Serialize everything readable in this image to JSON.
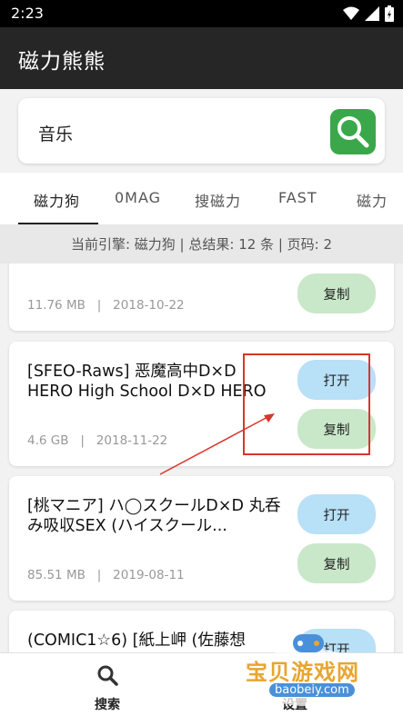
{
  "status_bar": {
    "time": "2:23"
  },
  "app_bar": {
    "title": "磁力熊熊"
  },
  "search": {
    "query": "音乐"
  },
  "tabs": [
    {
      "label": "磁力狗",
      "active": true
    },
    {
      "label": "0MAG",
      "active": false
    },
    {
      "label": "搜磁力",
      "active": false
    },
    {
      "label": "FAST",
      "active": false
    },
    {
      "label": "磁力",
      "active": false
    }
  ],
  "info_bar": {
    "text": "当前引擎: 磁力狗 | 总结果: 12 条 | 页码: 2"
  },
  "results": [
    {
      "name": "",
      "size": "11.76 MB",
      "date": "2018-10-22",
      "copy_label": "复制"
    },
    {
      "name": "[SFEO-Raws] 恶魔高中D×D HERO High School D×D HERO ...",
      "size": "4.6 GB",
      "date": "2018-11-22",
      "open_label": "打开",
      "copy_label": "复制"
    },
    {
      "name": "[桃マニア] ハ◯スクールD×D 丸呑み吸収SEX (ハイスクール...",
      "size": "85.51 MB",
      "date": "2019-08-11",
      "open_label": "打开",
      "copy_label": "复制"
    },
    {
      "name": "(COMIC1☆6) [紙上岬 (佐藤想",
      "open_label": "打开"
    }
  ],
  "meta_separator": "|",
  "bottom_nav": [
    {
      "label": "搜索",
      "icon": "search-icon"
    },
    {
      "label": "设置",
      "icon": "settings-icon"
    }
  ],
  "watermark": {
    "text": "宝贝游戏网",
    "url": "baobeiy.com"
  },
  "colors": {
    "app_bar": "#262626",
    "search_button": "#3aa84a",
    "open_button": "#b8e0f7",
    "copy_button": "#c9e8c9",
    "annotation": "#d9352b"
  }
}
